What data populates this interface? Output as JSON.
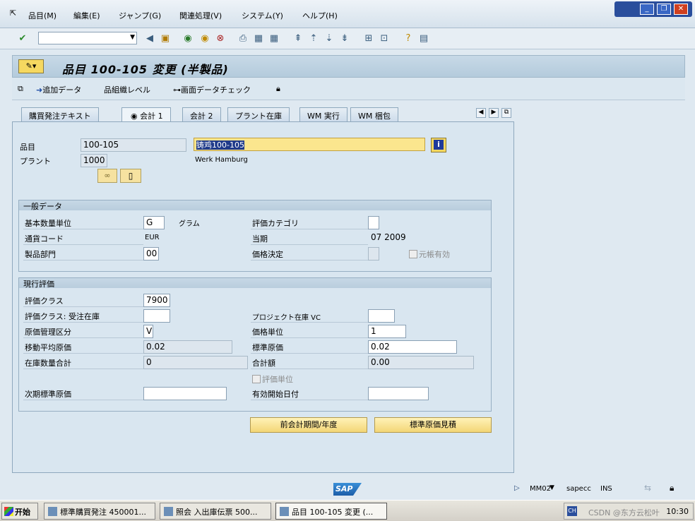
{
  "menubar": {
    "items": [
      "品目(M)",
      "編集(E)",
      "ジャンプ(G)",
      "関連処理(V)",
      "システム(Y)",
      "ヘルプ(H)"
    ]
  },
  "window_controls": {
    "minimize": "_",
    "restore": "❐",
    "close": "✕"
  },
  "title": "品目 100-105 変更 (半製品)",
  "app_toolbar": {
    "add_data": "追加データ",
    "org_levels": "組織レベル",
    "check_screen_data": "画面データチェック"
  },
  "tabs": [
    "購買発注テキスト",
    "会計 1",
    "会計 2",
    "プラント在庫",
    "WM 実行",
    "WM 梱包"
  ],
  "active_tab": "会計 1",
  "header": {
    "material_label": "品目",
    "material_value": "100-105",
    "material_desc": "铸鸡100-105",
    "plant_label": "プラント",
    "plant_value": "1000",
    "plant_name": "Werk Hamburg"
  },
  "general_data": {
    "title": "一般データ",
    "base_uom_label": "基本数量単位",
    "base_uom_value": "G",
    "base_uom_text": "グラム",
    "val_category_label": "評価カテゴリ",
    "val_category_value": "",
    "currency_label": "通貨コード",
    "currency_value": "EUR",
    "current_period_label": "当期",
    "current_period_value": "07 2009",
    "division_label": "製品部門",
    "division_value": "00",
    "price_determination_label": "価格決定",
    "price_determination_value": "",
    "ml_active_label": "元帳有効"
  },
  "current_valuation": {
    "title": "現行評価",
    "val_class_label": "評価クラス",
    "val_class_value": "7900",
    "val_class_so_label": "評価クラス: 受注在庫",
    "val_class_so_value": "",
    "project_stock_label": "プロジェクト在庫 VC",
    "project_stock_value": "",
    "price_control_label": "原価管理区分",
    "price_control_value": "V",
    "price_unit_label": "価格単位",
    "price_unit_value": "1",
    "moving_price_label": "移動平均原価",
    "moving_price_value": "0.02",
    "standard_price_label": "標準原価",
    "standard_price_value": "0.02",
    "total_stock_label": "在庫数量合計",
    "total_stock_value": "0",
    "total_value_label": "合計額",
    "total_value_value": "0.00",
    "valuated_unit_label": "評価単位",
    "future_price_label": "次期標準原価",
    "future_price_value": "",
    "valid_from_label": "有効開始日付",
    "valid_from_value": ""
  },
  "buttons": {
    "prev_period": "前会計期間/年度",
    "std_cost_estimate": "標準原価見積"
  },
  "status": {
    "tcode": "MM02",
    "system": "sapecc",
    "mode": "INS"
  },
  "taskbar": {
    "start": "开始",
    "tasks": [
      "標準購買発注 450001...",
      "照会 入出庫伝票 500...",
      "品目 100-105 変更 (..."
    ],
    "clock": "10:30",
    "watermark": "CSDN @东方云松叶"
  }
}
